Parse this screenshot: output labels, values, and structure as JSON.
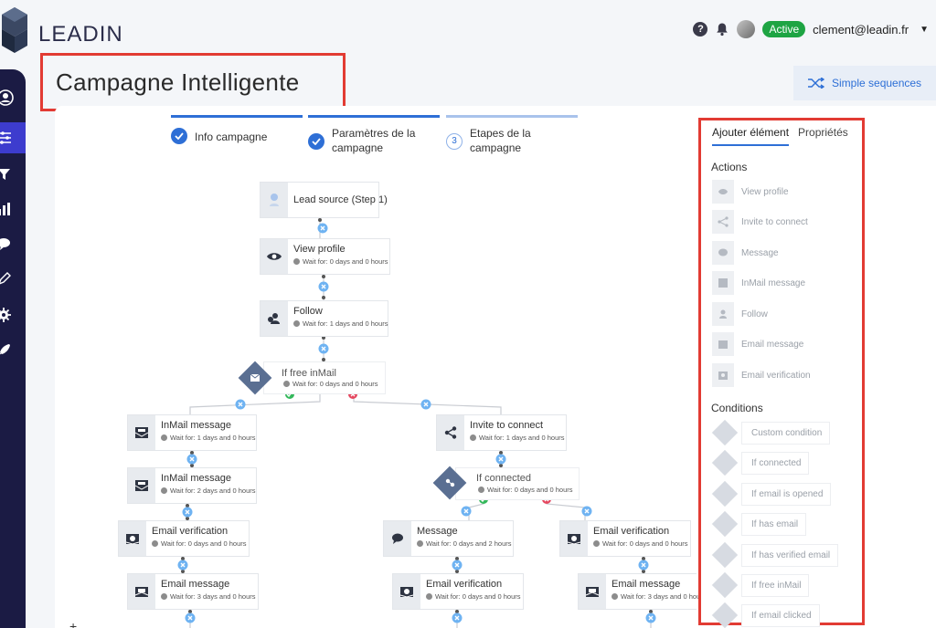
{
  "app": {
    "logo_text": "LEADIN",
    "help_label": "?",
    "status_badge": "Active",
    "user_email": "clement@leadin.fr",
    "accent": "#2e6fd6",
    "sidebar_color": "#1b1b44",
    "highlight_border": "#e23b33"
  },
  "page": {
    "title": "Campagne Intelligente",
    "mode_button": "Simple sequences"
  },
  "steps": [
    {
      "label_1": "Info campagne",
      "label_2": "",
      "state": "done"
    },
    {
      "label_1": "Paramètres de la",
      "label_2": "campagne",
      "state": "done"
    },
    {
      "label_1": "Etapes de la",
      "label_2": "campagne",
      "state": "current",
      "number": "3"
    }
  ],
  "flow": {
    "lead_source": {
      "title": "Lead source (Step 1)",
      "icon": "user-source-icon"
    },
    "view_profile": {
      "title": "View profile",
      "wait": "Wait for: 0 days and 0 hours",
      "icon": "eye-icon"
    },
    "follow": {
      "title": "Follow",
      "wait": "Wait for: 1 days and 0 hours",
      "icon": "follow-icon"
    },
    "if_free_inmail": {
      "title": "If free inMail",
      "wait": "Wait for: 0 days and 0 hours",
      "icon": "inmail-icon"
    },
    "left_inmail_1": {
      "title": "InMail message",
      "wait": "Wait for: 1 days and 0 hours",
      "icon": "inmail-icon"
    },
    "left_inmail_2": {
      "title": "InMail message",
      "wait": "Wait for: 2 days and 0 hours",
      "icon": "inmail-icon"
    },
    "left_email_verif": {
      "title": "Email verification",
      "wait": "Wait for: 0 days and 0 hours",
      "icon": "email-verification-icon"
    },
    "left_email_msg": {
      "title": "Email message",
      "wait": "Wait for: 3 days and 0 hours",
      "icon": "email-icon"
    },
    "invite": {
      "title": "Invite to connect",
      "wait": "Wait for: 1 days and 0 hours",
      "icon": "share-icon"
    },
    "if_connected": {
      "title": "If connected",
      "wait": "Wait for: 0 days and 0 hours",
      "icon": "connected-icon"
    },
    "mid_message": {
      "title": "Message",
      "wait": "Wait for: 0 days and 2 hours",
      "icon": "chat-icon"
    },
    "mid_email_verif": {
      "title": "Email verification",
      "wait": "Wait for: 0 days and 0 hours",
      "icon": "email-verification-icon"
    },
    "right_email_verif": {
      "title": "Email verification",
      "wait": "Wait for: 0 days and 0 hours",
      "icon": "email-verification-icon"
    },
    "right_email_msg": {
      "title": "Email message",
      "wait": "Wait for: 3 days and 0 hours",
      "icon": "email-icon"
    }
  },
  "panel": {
    "tabs": [
      "Ajouter élément",
      "Propriétés"
    ],
    "actions_title": "Actions",
    "actions": [
      {
        "label": "View profile",
        "icon": "eye-icon"
      },
      {
        "label": "Invite to connect",
        "icon": "share-icon"
      },
      {
        "label": "Message",
        "icon": "chat-icon"
      },
      {
        "label": "InMail message",
        "icon": "inmail-icon"
      },
      {
        "label": "Follow",
        "icon": "follow-icon"
      },
      {
        "label": "Email message",
        "icon": "email-icon"
      },
      {
        "label": "Email verification",
        "icon": "email-verification-icon"
      }
    ],
    "conditions_title": "Conditions",
    "conditions": [
      {
        "label": "Custom condition"
      },
      {
        "label": "If connected"
      },
      {
        "label": "If email is opened"
      },
      {
        "label": "If has email"
      },
      {
        "label": "If has verified email"
      },
      {
        "label": "If free inMail"
      },
      {
        "label": "If email clicked"
      }
    ]
  }
}
